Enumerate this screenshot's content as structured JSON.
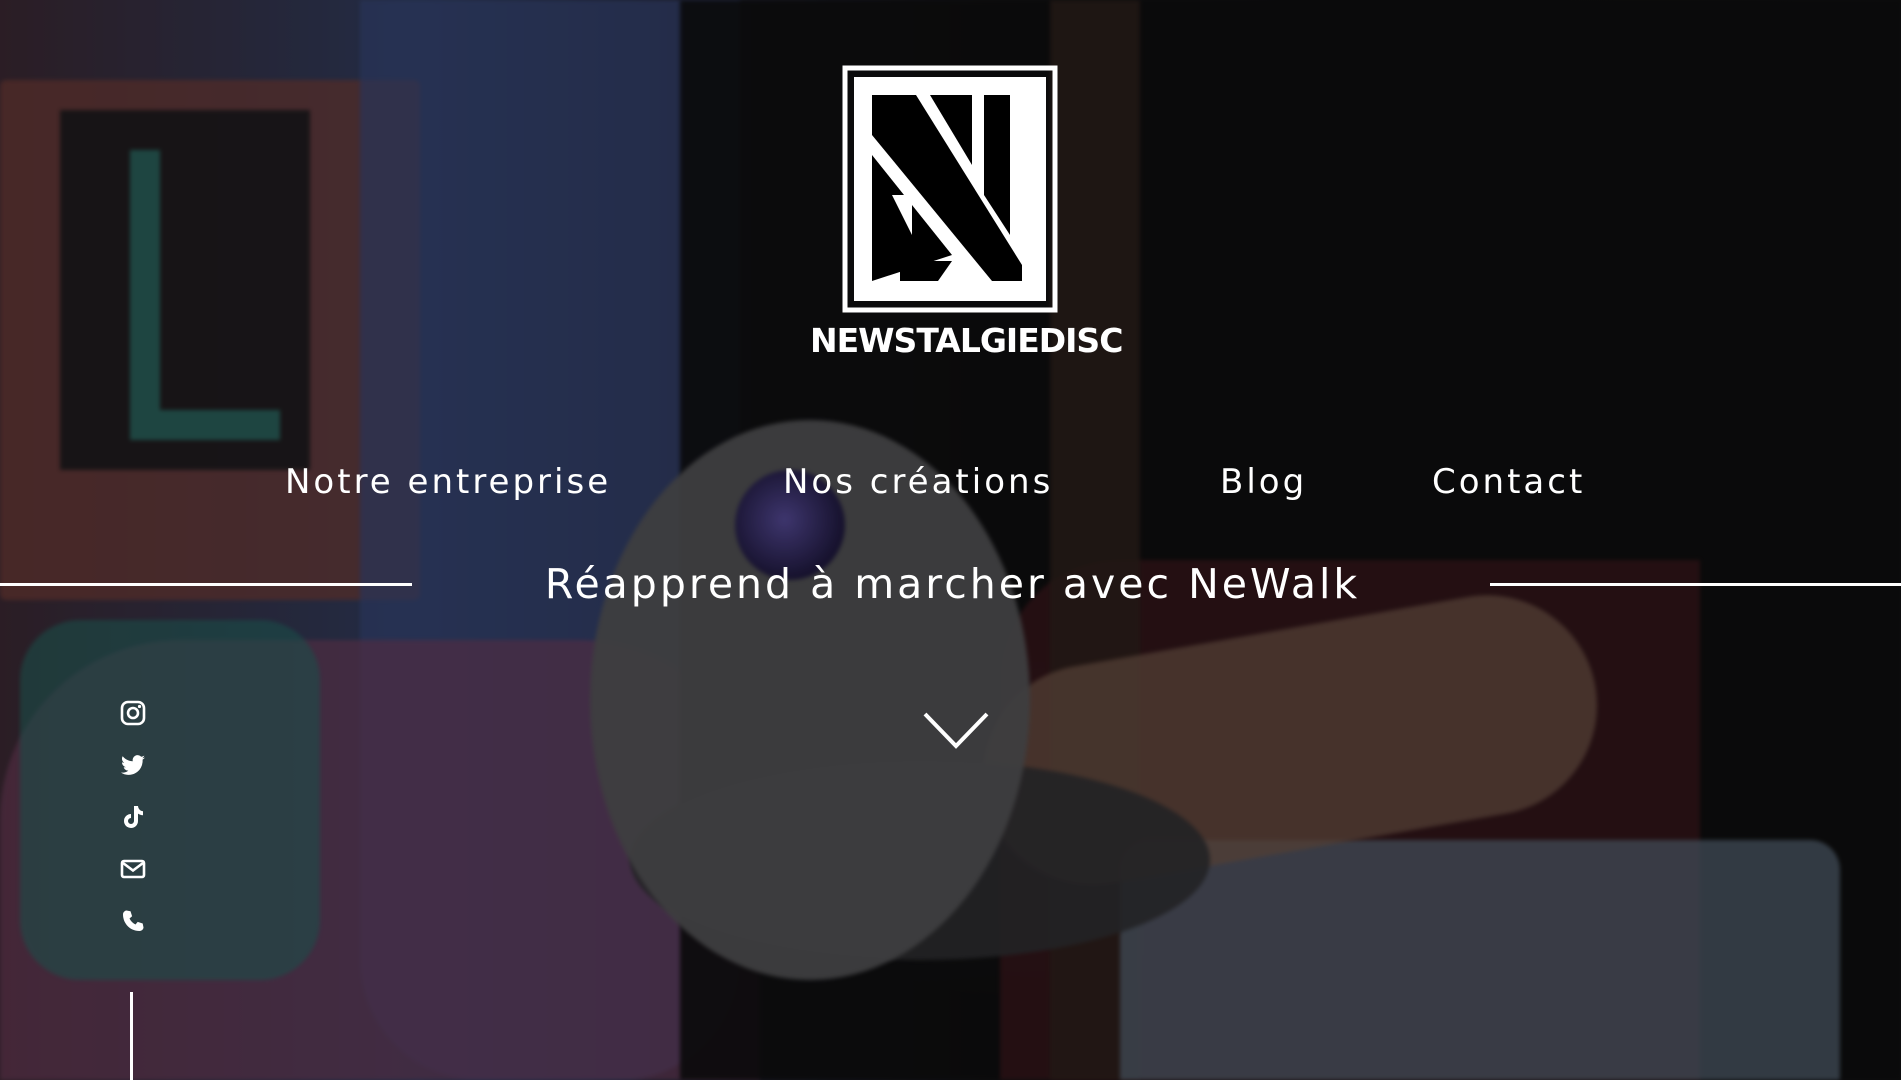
{
  "brand": {
    "name": "NEWSTALGIEDISC",
    "logo_icon": "ns-monogram-logo"
  },
  "nav": {
    "items": [
      {
        "label": "Notre entreprise"
      },
      {
        "label": "Nos créations"
      },
      {
        "label": "Blog"
      },
      {
        "label": "Contact"
      }
    ]
  },
  "hero": {
    "tagline": "Réapprend à marcher avec NeWalk",
    "scroll_icon": "chevron-down-icon"
  },
  "social": {
    "items": [
      {
        "icon": "instagram-icon"
      },
      {
        "icon": "twitter-icon"
      },
      {
        "icon": "tiktok-icon"
      },
      {
        "icon": "envelope-icon"
      },
      {
        "icon": "phone-icon"
      }
    ]
  },
  "colors": {
    "text": "#ffffff",
    "overlay": "#000000"
  }
}
